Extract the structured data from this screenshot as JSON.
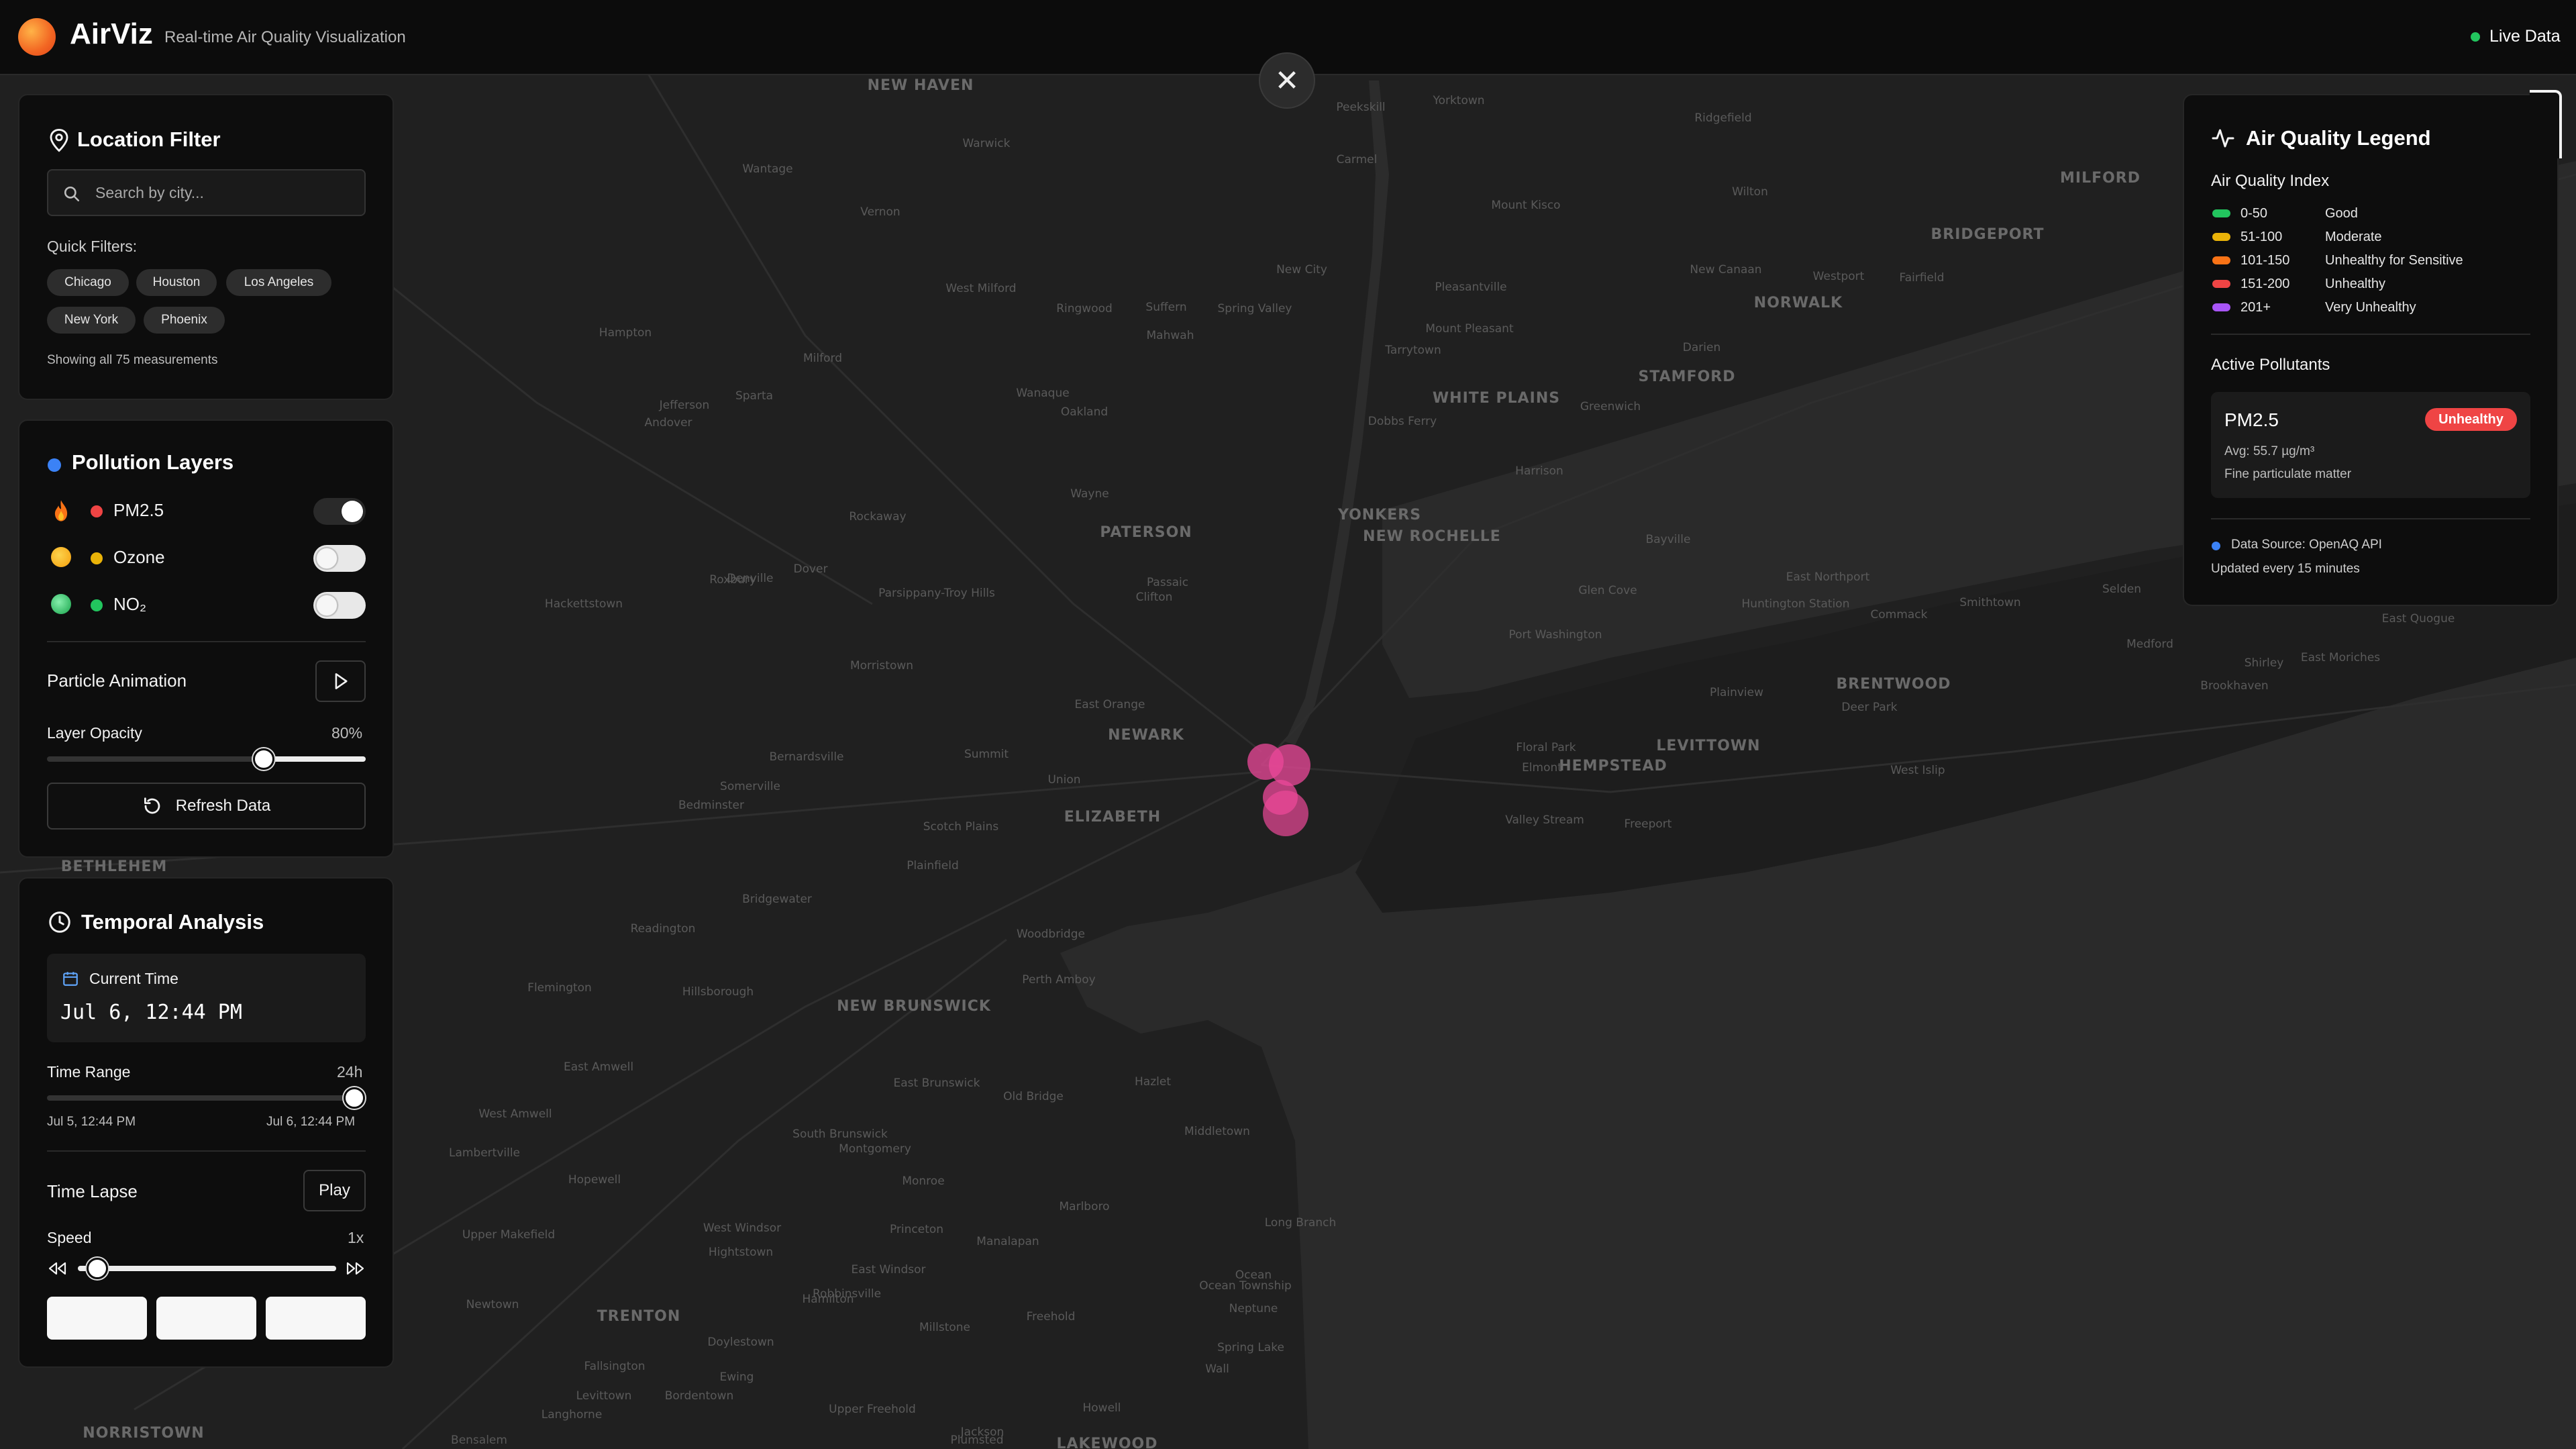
{
  "header": {
    "title": "AirViz",
    "subtitle": "Real-time Air Quality Visualization",
    "live_label": "Live Data",
    "live_color": "#22c55e"
  },
  "close_button": {
    "icon": "close-icon",
    "glyph": "✕"
  },
  "location_filter": {
    "title": "Location Filter",
    "icon": "map-pin-icon",
    "search_placeholder": "Search by city...",
    "quick_filters_label": "Quick Filters:",
    "quick_filters": [
      "Chicago",
      "Houston",
      "Los Angeles",
      "New York",
      "Phoenix"
    ],
    "status": "Showing all 75 measurements"
  },
  "pollution_layers": {
    "title": "Pollution Layers",
    "layers": [
      {
        "label": "PM2.5",
        "icon": "flame-icon",
        "color": "#ef4444",
        "enabled": true
      },
      {
        "label": "Ozone",
        "icon": "sun-icon",
        "color": "#eab308",
        "enabled": false
      },
      {
        "label": "NO₂",
        "icon": "gas-icon",
        "color": "#22c55e",
        "enabled": false
      }
    ],
    "particle_animation_label": "Particle Animation",
    "opacity_label": "Layer Opacity",
    "opacity_value": "80%",
    "opacity_fraction": 0.8,
    "refresh_label": "Refresh Data"
  },
  "temporal": {
    "title": "Temporal Analysis",
    "current_time_label": "Current Time",
    "current_time": "Jul 6, 12:44 PM",
    "range_label": "Time Range",
    "range_value": "24h",
    "range_fraction": 1.0,
    "range_start": "Jul 5, 12:44 PM",
    "range_end": "Jul 6, 12:44 PM",
    "lapse_label": "Time Lapse",
    "play_label": "Play",
    "speed_label": "Speed",
    "speed_value": "1x",
    "speed_fraction": 0.25
  },
  "legend": {
    "title": "Air Quality Legend",
    "aqi_label": "Air Quality Index",
    "rows": [
      {
        "range": "0-50",
        "desc": "Good",
        "color": "#22c55e"
      },
      {
        "range": "51-100",
        "desc": "Moderate",
        "color": "#eab308"
      },
      {
        "range": "101-150",
        "desc": "Unhealthy for Sensitive",
        "color": "#f97316"
      },
      {
        "range": "151-200",
        "desc": "Unhealthy",
        "color": "#ef4444"
      },
      {
        "range": "201+",
        "desc": "Very Unhealthy",
        "color": "#a855f7"
      }
    ],
    "active_label": "Active Pollutants",
    "pollutant": {
      "name": "PM2.5",
      "badge": "Unhealthy",
      "avg": "Avg: 55.7 µg/m³",
      "desc": "Fine particulate matter"
    },
    "source": "Data Source: OpenAQ API",
    "update_note": "Updated every 15 minutes",
    "source_color": "#3b82f6"
  },
  "map_labels": [
    "NEW HAVEN",
    "MILFORD",
    "BRIDGEPORT",
    "NORWALK",
    "STAMFORD",
    "WHITE PLAINS",
    "YONKERS",
    "NEW ROCHELLE",
    "PATERSON",
    "NEWARK",
    "ELIZABETH",
    "NEW BRUNSWICK",
    "TRENTON",
    "HEMPSTEAD",
    "LEVITTOWN",
    "BRENTWOOD",
    "BETHLEHEM",
    "NORRISTOWN",
    "LAKEWOOD",
    "Peekskill",
    "Yorktown",
    "Ridgefield",
    "Warwick",
    "Carmel",
    "Mount Kisco",
    "Wilton",
    "Fairfield",
    "Westport",
    "New Canaan",
    "Darien",
    "Greenwich",
    "Pleasantville",
    "Mount Pleasant",
    "Tarrytown",
    "Dobbs Ferry",
    "Harrison",
    "Suffern",
    "Mahwah",
    "Spring Valley",
    "New City",
    "Ringwood",
    "Wanaque",
    "Oakland",
    "Wayne",
    "Clifton",
    "Passaic",
    "East Orange",
    "Union",
    "Summit",
    "Plainfield",
    "Scotch Plains",
    "Woodbridge",
    "Perth Amboy",
    "East Brunswick",
    "Old Bridge",
    "Hazlet",
    "Middletown",
    "Marlboro",
    "Manalapan",
    "Freehold",
    "Long Branch",
    "Ocean",
    "Neptune",
    "Howell",
    "Jackson",
    "Wall",
    "Flemington",
    "Somerville",
    "Hillsborough",
    "Bedminster",
    "Morristown",
    "Dover",
    "Denville",
    "Bernardsville",
    "Bridgewater",
    "Montgomery",
    "Princeton",
    "Hopewell",
    "Lambertville",
    "Doylestown",
    "Newtown",
    "Langhorne",
    "Bensalem",
    "Fallsington",
    "Levittown",
    "Bordentown",
    "Robbinsville",
    "Hightstown",
    "Monroe",
    "South Brunswick",
    "East Windsor",
    "West Windsor",
    "Millstone",
    "Upper Freehold",
    "Plumsted",
    "Floral Park",
    "Elmont",
    "Valley Stream",
    "Freeport",
    "East Northport",
    "Huntington Station",
    "Commack",
    "Smithtown",
    "Selden",
    "Medford",
    "Shirley",
    "East Moriches",
    "East Quogue",
    "Brookhaven",
    "Deer Park",
    "West Islip",
    "Plainview",
    "Glen Cove",
    "Port Washington",
    "Bayville",
    "Hackettstown",
    "Roxbury",
    "Parsippany-Troy Hills",
    "Rockaway",
    "Jefferson",
    "Vernon",
    "Hampton",
    "Andover",
    "Sparta",
    "Wantage",
    "West Milford",
    "Milford",
    "Spring Lake",
    "Ocean Township",
    "Readington",
    "Hamilton",
    "Ewing",
    "Upper Makefield",
    "West Amwell",
    "East Amwell"
  ]
}
